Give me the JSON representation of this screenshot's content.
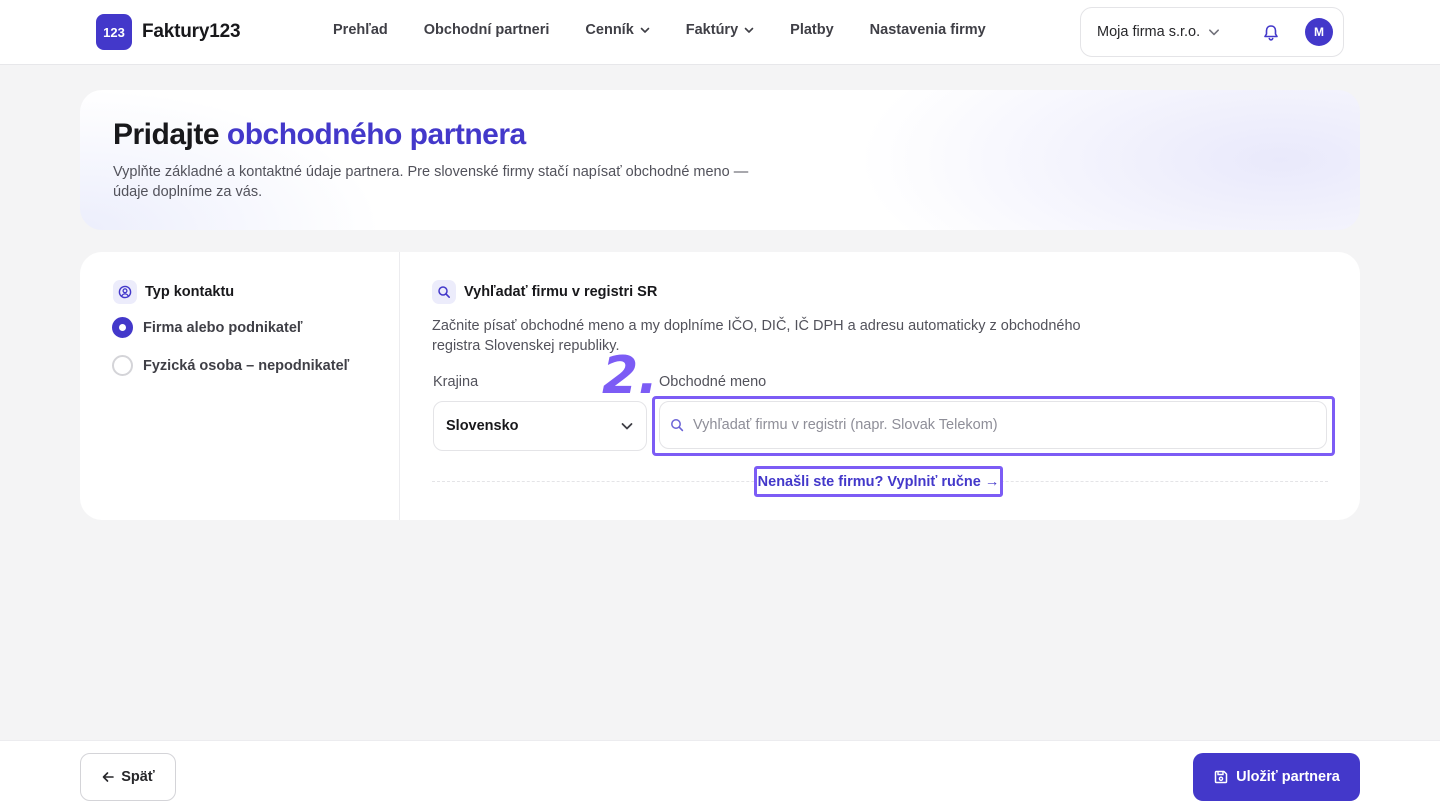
{
  "brand": {
    "badge": "123",
    "name": "Faktury123"
  },
  "nav": {
    "items": [
      {
        "label": "Prehľad",
        "dropdown": false
      },
      {
        "label": "Obchodní partneri",
        "dropdown": false
      },
      {
        "label": "Cenník",
        "dropdown": true
      },
      {
        "label": "Faktúry",
        "dropdown": true
      },
      {
        "label": "Platby",
        "dropdown": false
      },
      {
        "label": "Nastavenia firmy",
        "dropdown": false
      }
    ]
  },
  "header": {
    "company_name": "Moja firma s.r.o.",
    "bell_icon": "bell-icon",
    "avatar_initial": "M"
  },
  "hero": {
    "title_plain": "Pridajte ",
    "title_accent": "obchodného partnera",
    "subtitle": "Vyplňte základné a kontaktné údaje partnera. Pre slovenské firmy stačí napísať obchodné meno — údaje doplníme za vás."
  },
  "contact_type": {
    "title": "Typ kontaktu",
    "icon": "user-circle-icon",
    "options": [
      {
        "label": "Firma alebo podnikateľ",
        "selected": true
      },
      {
        "label": "Fyzická osoba – nepodnikateľ",
        "selected": false
      }
    ]
  },
  "registry": {
    "title": "Vyhľadať firmu v registri SR",
    "icon": "search-icon",
    "description": "Začnite písať obchodné meno a my doplníme IČO, DIČ, IČ DPH a adresu automaticky z obchodného registra Slovenskej republiky.",
    "country_label": "Krajina",
    "country_value": "Slovensko",
    "name_label": "Obchodné meno",
    "search_value": "",
    "search_placeholder": "Vyhľadať firmu v registri (napr. Slovak Telekom)",
    "manual_link": "Nenašli ste firmu? Vyplniť ručne →",
    "step_annotation": "2."
  },
  "footer": {
    "back_label": "Späť",
    "save_label": "Uložiť partnera"
  },
  "colors": {
    "accent": "#4338ca",
    "highlight": "#7c5cf5",
    "background": "#f4f4f5"
  }
}
